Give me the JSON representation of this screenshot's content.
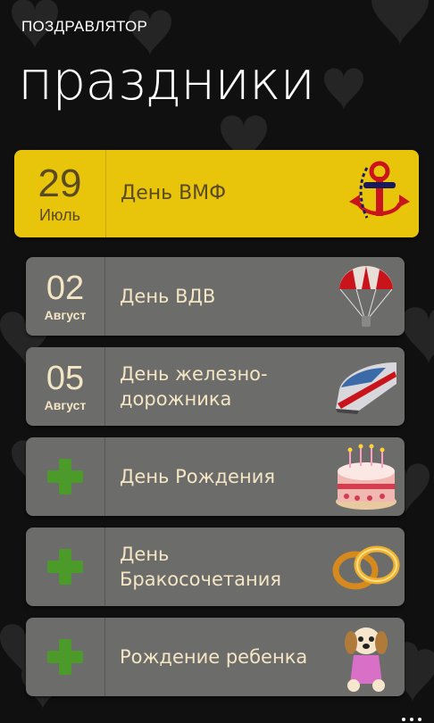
{
  "app": {
    "title": "ПОЗДРАВЛЯТОР",
    "page_title": "праздники"
  },
  "holidays": [
    {
      "day": "29",
      "month": "Июль",
      "name": "День ВМФ",
      "icon": "anchor-icon"
    },
    {
      "day": "02",
      "month": "Август",
      "name": "День ВДВ",
      "icon": "parachute-icon"
    },
    {
      "day": "05",
      "month": "Август",
      "name": "День железно-дорожника",
      "icon": "train-icon"
    },
    {
      "day": "",
      "month": "",
      "name": "День Рождения",
      "icon": "cake-icon"
    },
    {
      "day": "",
      "month": "",
      "name": "День Бракосочетания",
      "icon": "rings-icon"
    },
    {
      "day": "",
      "month": "",
      "name": "Рождение ребенка",
      "icon": "baby-dog-icon"
    }
  ],
  "colors": {
    "featured": "#e8c40a",
    "card": "#6c6c6a",
    "plus": "#4c9a2a"
  }
}
